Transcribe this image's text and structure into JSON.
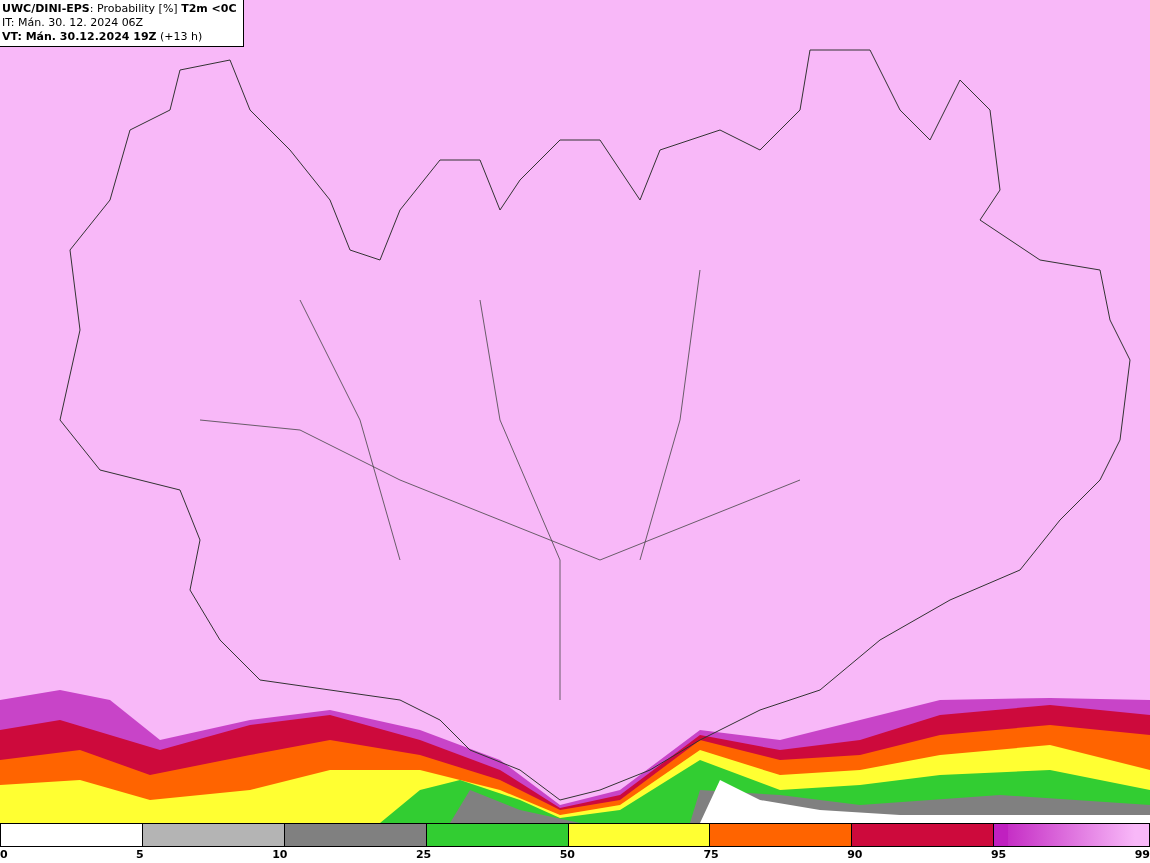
{
  "header": {
    "lines": [
      "**UWC/DINI-EPS**: Probability [%] **T2m <0C**",
      "IT: Mán. 30. 12. 2024 06Z",
      "**VT: Mán. 30.12.2024 19Z** (+13 h)"
    ]
  },
  "legend": {
    "segments": [
      {
        "kind": "solid",
        "color": "#ffffff"
      },
      {
        "kind": "solid",
        "color": "#b4b4b4"
      },
      {
        "kind": "solid",
        "color": "#808080"
      },
      {
        "kind": "solid",
        "color": "#32cd32"
      },
      {
        "kind": "solid",
        "color": "#ffff32"
      },
      {
        "kind": "solid",
        "color": "#ff6400"
      },
      {
        "kind": "solid",
        "color": "#cd0a3c"
      },
      {
        "kind": "gradient",
        "color": "#c020c0"
      },
      {
        "kind": "end",
        "color": "#f8b8f8"
      }
    ],
    "labels": [
      "0",
      "5",
      "10",
      "25",
      "50",
      "75",
      "90",
      "95",
      "99"
    ]
  }
}
